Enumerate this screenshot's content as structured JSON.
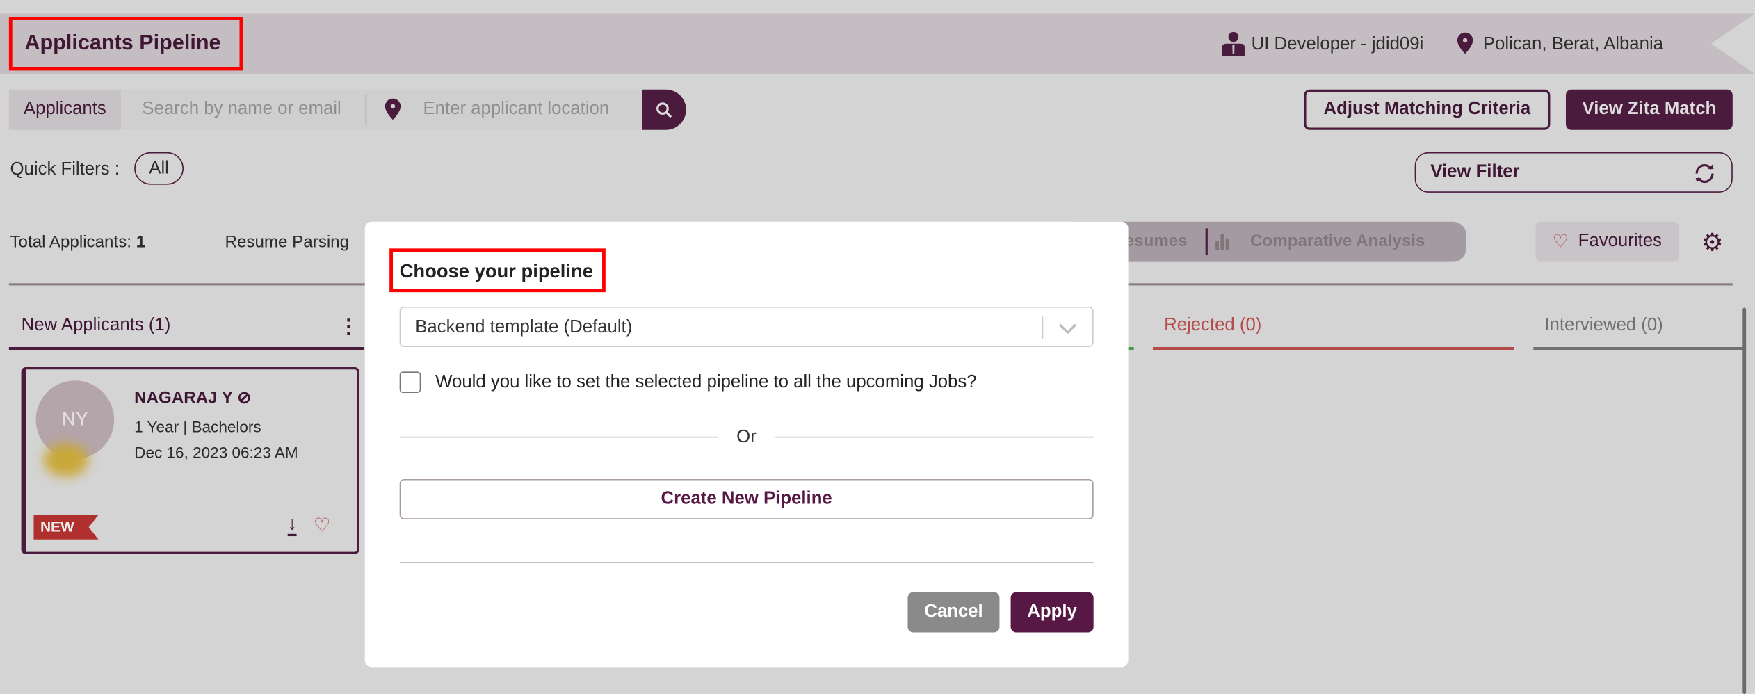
{
  "header": {
    "title": "Applicants Pipeline",
    "job": "UI Developer - jdid09i",
    "location": "Polican, Berat, Albania"
  },
  "search": {
    "tab_label": "Applicants",
    "name_placeholder": "Search by name or email",
    "location_placeholder": "Enter applicant location"
  },
  "actions": {
    "adjust_label": "Adjust Matching Criteria",
    "zita_label": "View Zita Match",
    "view_filter_label": "View Filter"
  },
  "quick_filters": {
    "label": "Quick Filters :",
    "options": [
      "All"
    ]
  },
  "stats": {
    "total_label": "Total Applicants:",
    "total_value": "1",
    "resume_parsing": "Resume Parsing",
    "resumes_tab": "esumes",
    "comparative": "Comparative Analysis",
    "favourites": "Favourites"
  },
  "columns": [
    {
      "label": "New Applicants (1)",
      "color": "#3f1634"
    },
    {
      "label": "Rejected (0)",
      "color": "#b54a4a"
    },
    {
      "label": "Interviewed (0)",
      "color": "#707070"
    }
  ],
  "card": {
    "initials": "NY",
    "name": "NAGARAJ Y",
    "experience": "1 Year",
    "education": "Bachelors",
    "date": "Dec 16, 2023 06:23 AM",
    "badge": "NEW"
  },
  "modal": {
    "title": "Choose your pipeline",
    "selected": "Backend template (Default)",
    "checkbox_label": "Would you like to set the selected pipeline to all the upcoming Jobs?",
    "checkbox_checked": false,
    "or": "Or",
    "create_label": "Create New Pipeline",
    "cancel_label": "Cancel",
    "apply_label": "Apply"
  },
  "colors": {
    "brand": "#581845",
    "highlight": "#ff0000"
  }
}
